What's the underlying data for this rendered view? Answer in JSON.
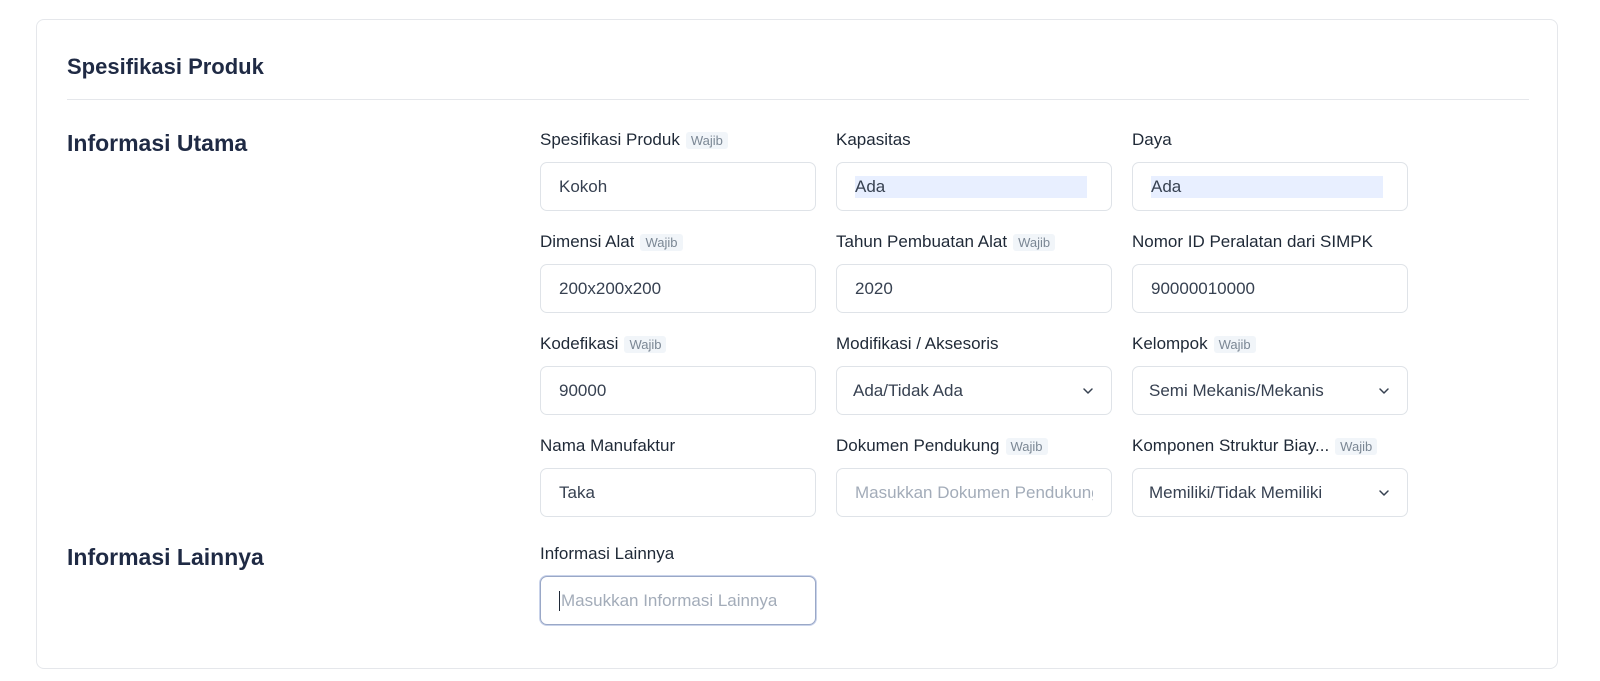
{
  "card": {
    "title": "Spesifikasi Produk"
  },
  "sections": {
    "main": {
      "title": "Informasi Utama"
    },
    "other": {
      "title": "Informasi Lainnya"
    }
  },
  "badge_text": "Wajib",
  "fields": {
    "spesifikasi": {
      "label": "Spesifikasi Produk",
      "value": "Kokoh"
    },
    "kapasitas": {
      "label": "Kapasitas",
      "value": "Ada"
    },
    "daya": {
      "label": "Daya",
      "value": "Ada"
    },
    "dimensi": {
      "label": "Dimensi Alat",
      "value": "200x200x200"
    },
    "tahun": {
      "label": "Tahun Pembuatan Alat",
      "value": "2020"
    },
    "nomor_id": {
      "label": "Nomor ID Peralatan dari SIMPK",
      "value": "90000010000"
    },
    "kodefikasi": {
      "label": "Kodefikasi",
      "value": "90000"
    },
    "modifikasi": {
      "label": "Modifikasi / Aksesoris",
      "value": "Ada/Tidak Ada"
    },
    "kelompok": {
      "label": "Kelompok",
      "value": "Semi Mekanis/Mekanis"
    },
    "manufaktur": {
      "label": "Nama Manufaktur",
      "value": "Taka"
    },
    "dokumen": {
      "label": "Dokumen Pendukung",
      "placeholder": "Masukkan Dokumen Pendukung"
    },
    "komponen": {
      "label": "Komponen Struktur Biay...",
      "value": "Memiliki/Tidak Memiliki"
    },
    "info_lainnya": {
      "label": "Informasi Lainnya",
      "placeholder": "Masukkan Informasi Lainnya"
    }
  },
  "colors": {
    "border": "#dfe3e8",
    "highlight": "#e8efff",
    "heading": "#1f2a44",
    "badge_bg": "#f1f5f9"
  }
}
